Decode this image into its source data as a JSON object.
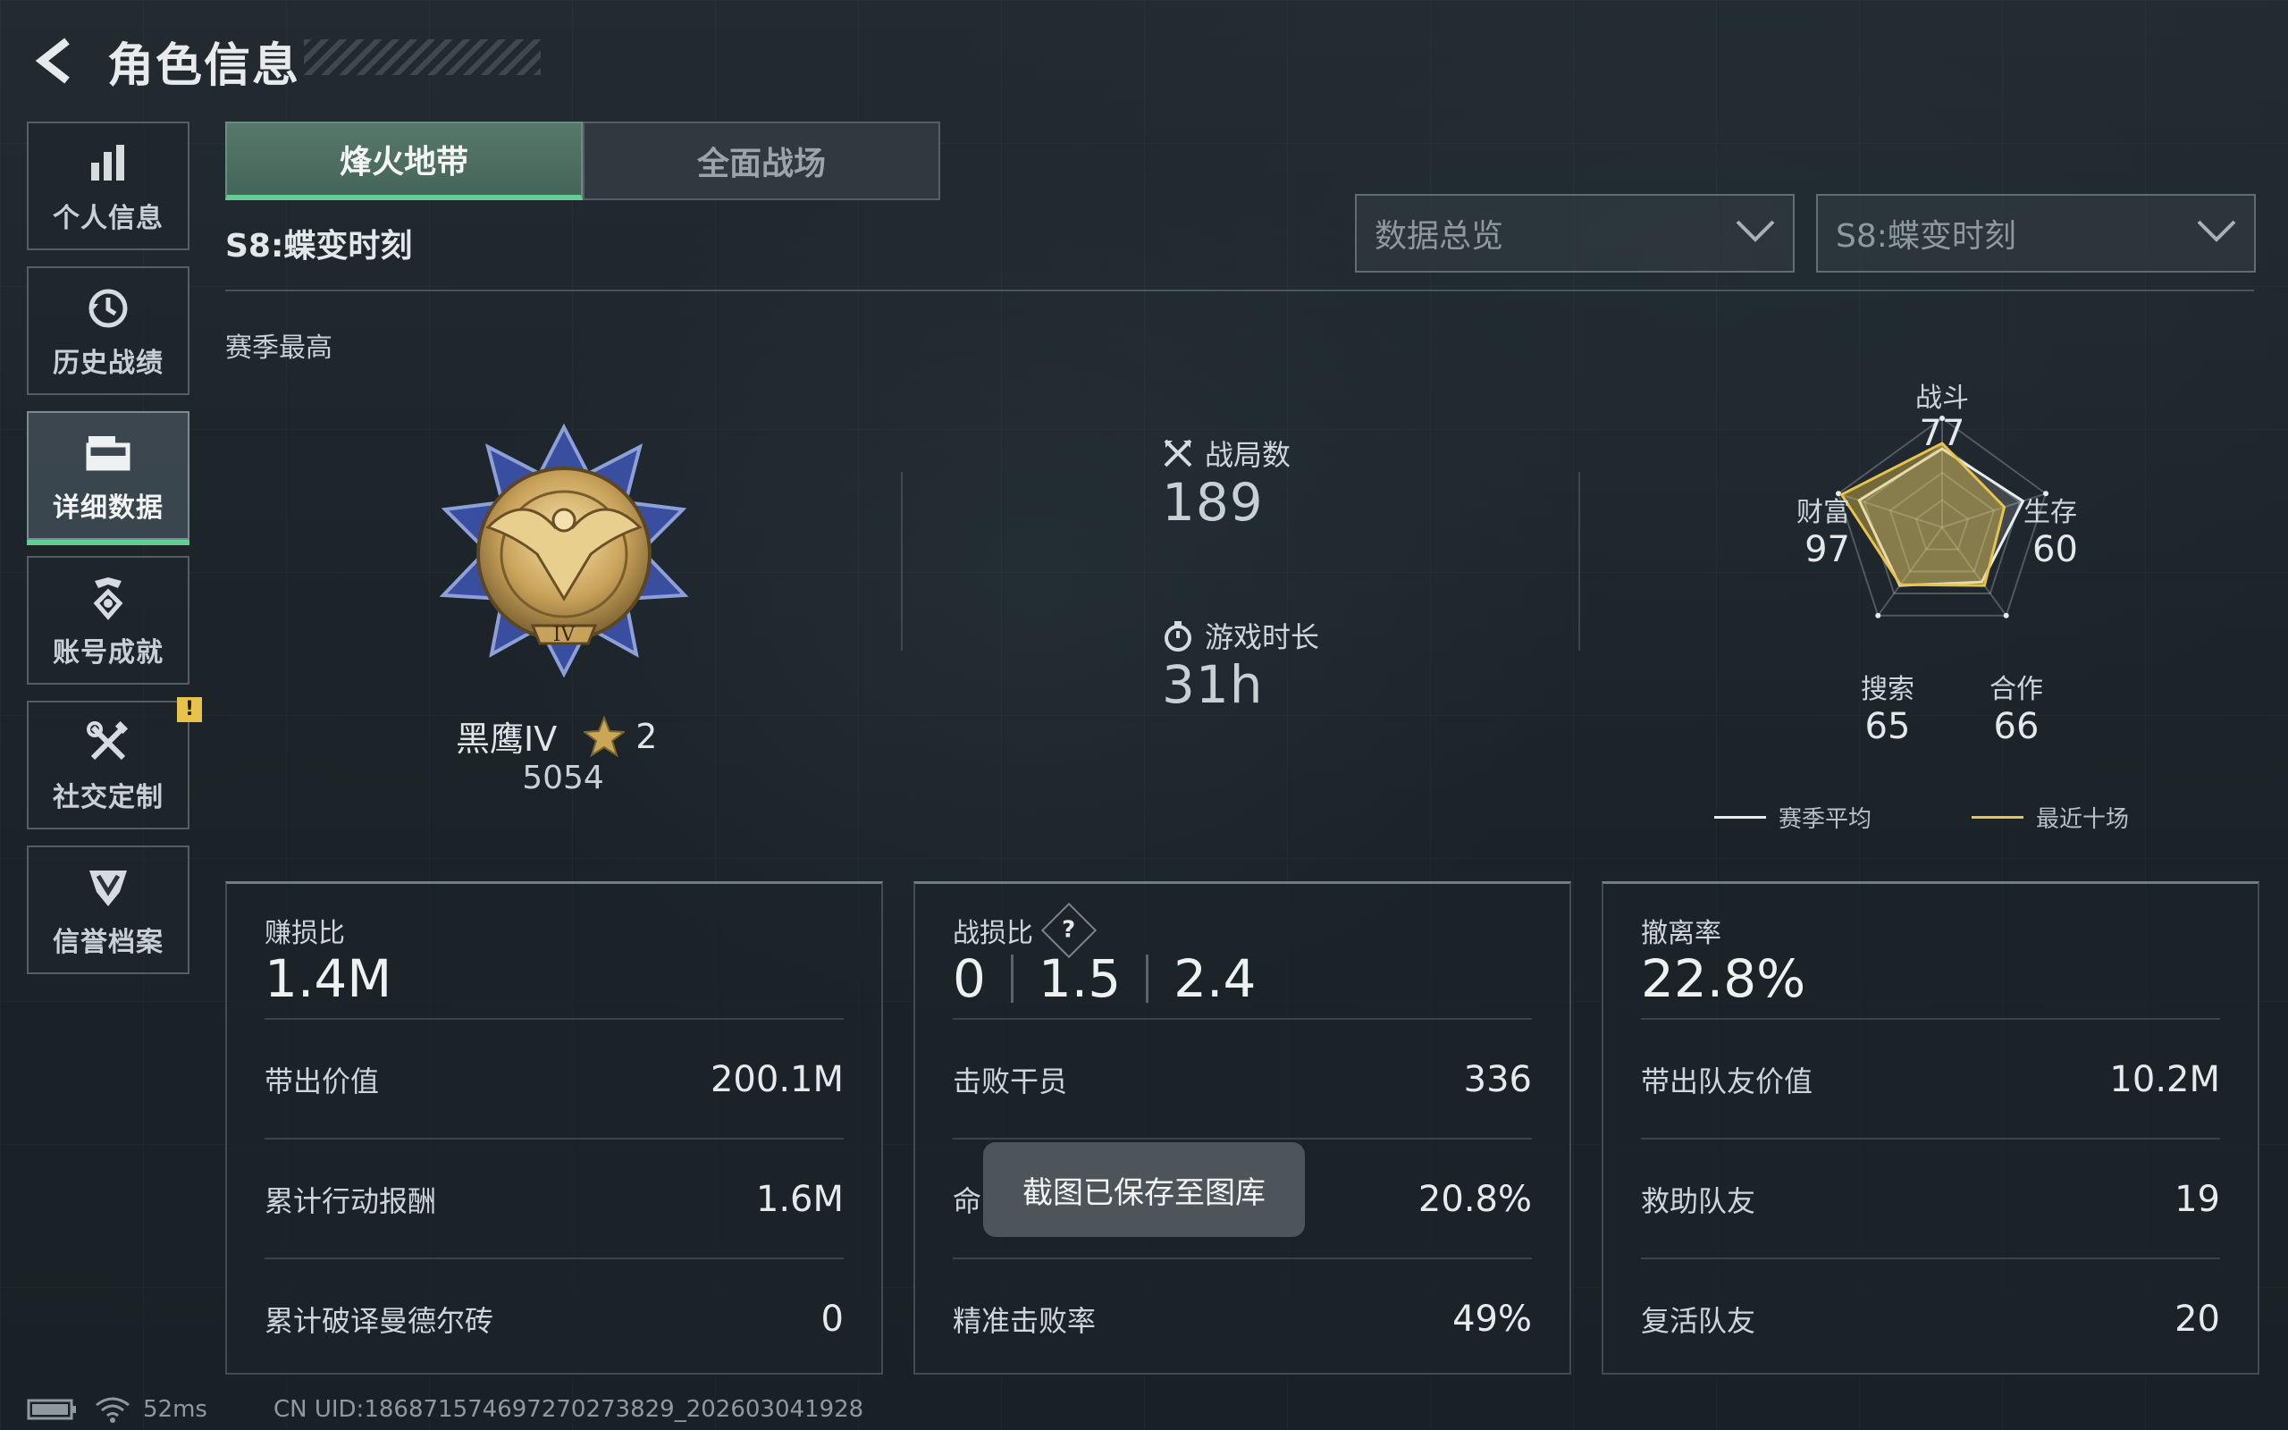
{
  "header": {
    "title": "角色信息",
    "back_icon": "back-arrow-icon"
  },
  "sidebar": {
    "items": [
      {
        "label": "个人信息",
        "icon": "bar-chart-icon"
      },
      {
        "label": "历史战绩",
        "icon": "history-clock-icon"
      },
      {
        "label": "详细数据",
        "icon": "folder-icon",
        "active": true
      },
      {
        "label": "账号成就",
        "icon": "achievement-icon"
      },
      {
        "label": "社交定制",
        "icon": "tools-icon",
        "badge": "!"
      },
      {
        "label": "信誉档案",
        "icon": "shield-emblem-icon"
      }
    ]
  },
  "tabs": [
    {
      "label": "烽火地带",
      "active": true
    },
    {
      "label": "全面战场",
      "active": false
    }
  ],
  "season_label": "S8:蝶变时刻",
  "filters": {
    "view_select": "数据总览",
    "season_select": "S8:蝶变时刻"
  },
  "season_best_label": "赛季最高",
  "rank": {
    "name": "黑鹰IV",
    "stars": "2",
    "score": "5054",
    "emblem_numeral": "IV"
  },
  "match_stats": {
    "matches_label": "战局数",
    "matches_value": "189",
    "playtime_label": "游戏时长",
    "playtime_value": "31h"
  },
  "radar": {
    "axes": [
      {
        "label": "战斗",
        "value": "77"
      },
      {
        "label": "生存",
        "value": "60"
      },
      {
        "label": "合作",
        "value": "66"
      },
      {
        "label": "搜索",
        "value": "65"
      },
      {
        "label": "财富",
        "value": "97"
      }
    ],
    "season_avg": [
      0.72,
      0.78,
      0.62,
      0.66,
      0.8
    ],
    "recent_ten": [
      0.77,
      0.6,
      0.66,
      0.65,
      0.97
    ],
    "legend": [
      {
        "label": "赛季平均",
        "color": "#e8ecee"
      },
      {
        "label": "最近十场",
        "color": "#e7c34a"
      }
    ]
  },
  "cards": {
    "profit": {
      "title": "赚损比",
      "big": "1.4M",
      "rows": [
        {
          "label": "带出价值",
          "value": "200.1M"
        },
        {
          "label": "累计行动报酬",
          "value": "1.6M"
        },
        {
          "label": "累计破译曼德尔砖",
          "value": "0"
        }
      ]
    },
    "combat": {
      "title": "战损比",
      "big_values": [
        "0",
        "1.5",
        "2.4"
      ],
      "rows": [
        {
          "label": "击败干员",
          "value": "336"
        },
        {
          "label": "命",
          "value": "20.8%"
        },
        {
          "label": "精准击败率",
          "value": "49%"
        }
      ]
    },
    "extract": {
      "title": "撤离率",
      "big": "22.8%",
      "rows": [
        {
          "label": "带出队友价值",
          "value": "10.2M"
        },
        {
          "label": "救助队友",
          "value": "19"
        },
        {
          "label": "复活队友",
          "value": "20"
        }
      ]
    }
  },
  "toast": "截图已保存至图库",
  "footer": {
    "ping": "52ms",
    "uid": "CN UID:18687157469727027382​9_202603041928"
  },
  "colors": {
    "accent_green": "#5fcf92",
    "gold": "#e7c34a",
    "badge": "#e8c34a"
  }
}
